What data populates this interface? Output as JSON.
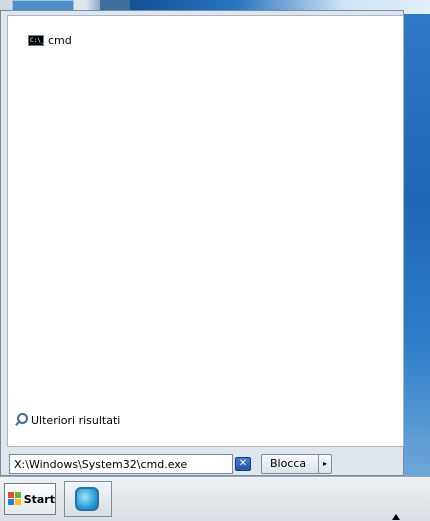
{
  "menu": {
    "results": [
      {
        "label": "cmd",
        "icon": "cmd-icon"
      }
    ],
    "more_results": "Ulteriori risultati"
  },
  "search": {
    "value": "X:\\Windows\\System32\\cmd.exe",
    "clear_icon": "close-icon"
  },
  "shutdown": {
    "label": "Blocca",
    "arrow": "▸"
  },
  "taskbar": {
    "start_label": "Start",
    "pinned_app_icon": "control-panel-icon"
  }
}
